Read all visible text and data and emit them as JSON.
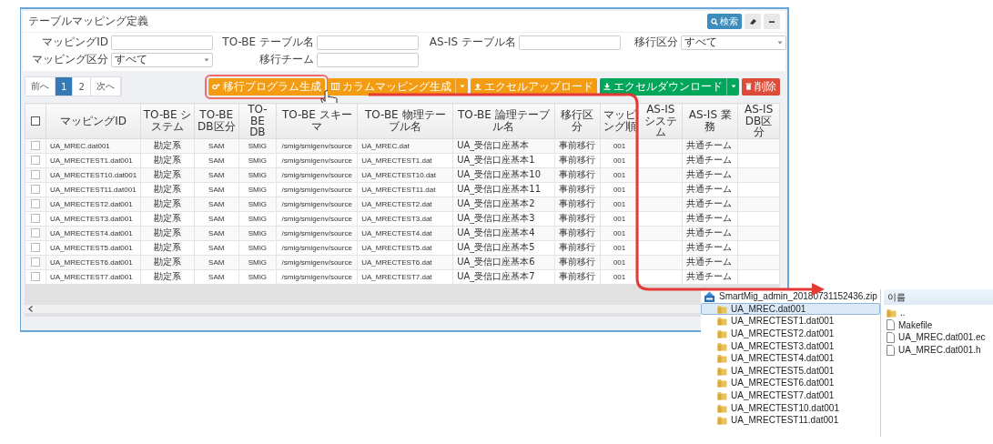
{
  "page": {
    "title": "テーブルマッピング定義"
  },
  "header_buttons": [
    {
      "kind": "search",
      "label": "検索"
    },
    {
      "kind": "eraser"
    },
    {
      "kind": "minimize"
    }
  ],
  "filters": [
    {
      "kind": "input",
      "label": "マッピングID"
    },
    {
      "kind": "input",
      "label": "TO-BE テーブル名"
    },
    {
      "kind": "input",
      "label": "AS-IS テーブル名"
    },
    {
      "kind": "select",
      "label": "移行区分",
      "value": "すべて"
    },
    {
      "kind": "select",
      "label": "マッピング区分",
      "value": "すべて"
    },
    {
      "kind": "input",
      "label": "移行チーム"
    }
  ],
  "pagination": [
    {
      "label": "前へ",
      "selected": false
    },
    {
      "label": "1",
      "selected": true
    },
    {
      "label": "2",
      "selected": false
    },
    {
      "label": "次へ",
      "selected": false
    }
  ],
  "toolbar": [
    {
      "kind": "program",
      "label": "移行プログラム生成",
      "color": "#f39c12",
      "dropdown": false,
      "highlighted": true
    },
    {
      "kind": "columns",
      "label": "カラムマッピング生成",
      "color": "#f39c12",
      "dropdown": true,
      "highlighted": false
    },
    {
      "kind": "upload",
      "label": "エクセルアップロード",
      "color": "#f39c12",
      "dropdown": false,
      "highlighted": false
    },
    {
      "kind": "download",
      "label": "エクセルダウンロード",
      "color": "#00a65a",
      "dropdown": true,
      "highlighted": false
    },
    {
      "kind": "delete",
      "label": "削除",
      "color": "#dd4b39",
      "dropdown": false,
      "highlighted": false
    }
  ],
  "table": {
    "select_all_checked": false,
    "columns": [
      "マッピングID",
      "TO-BE システム",
      "TO-BE DB区分",
      "TO-BE DB",
      "TO-BE スキーマ",
      "TO-BE 物理テーブル名",
      "TO-BE 論理テーブル名",
      "移行区分",
      "マッピング順",
      "AS-IS システム",
      "AS-IS 業務",
      "AS-IS DB区分"
    ],
    "rows": [
      {
        "checked": false,
        "mapping_id": "UA_MREC.dat001",
        "to_be_system": "勘定系",
        "to_be_db_type": "SAM",
        "to_be_db": "SMIG",
        "to_be_schema": "/smig/smigenv/source",
        "to_be_physical_table": "UA_MREC.dat",
        "to_be_logical_table": "UA_受信口座基本",
        "migration_type": "事前移行",
        "mapping_order": "001",
        "as_is_business": "共通チーム"
      },
      {
        "checked": false,
        "mapping_id": "UA_MRECTEST1.dat001",
        "to_be_system": "勘定系",
        "to_be_db_type": "SAM",
        "to_be_db": "SMIG",
        "to_be_schema": "/smig/smigenv/source",
        "to_be_physical_table": "UA_MRECTEST1.dat",
        "to_be_logical_table": "UA_受信口座基本1",
        "migration_type": "事前移行",
        "mapping_order": "001",
        "as_is_business": "共通チーム"
      },
      {
        "checked": false,
        "mapping_id": "UA_MRECTEST10.dat001",
        "to_be_system": "勘定系",
        "to_be_db_type": "SAM",
        "to_be_db": "SMIG",
        "to_be_schema": "/smig/smigenv/source",
        "to_be_physical_table": "UA_MRECTEST10.dat",
        "to_be_logical_table": "UA_受信口座基本10",
        "migration_type": "事前移行",
        "mapping_order": "001",
        "as_is_business": "共通チーム"
      },
      {
        "checked": false,
        "mapping_id": "UA_MRECTEST11.dat001",
        "to_be_system": "勘定系",
        "to_be_db_type": "SAM",
        "to_be_db": "SMIG",
        "to_be_schema": "/smig/smigenv/source",
        "to_be_physical_table": "UA_MRECTEST11.dat",
        "to_be_logical_table": "UA_受信口座基本11",
        "migration_type": "事前移行",
        "mapping_order": "001",
        "as_is_business": "共通チーム"
      },
      {
        "checked": false,
        "mapping_id": "UA_MRECTEST2.dat001",
        "to_be_system": "勘定系",
        "to_be_db_type": "SAM",
        "to_be_db": "SMIG",
        "to_be_schema": "/smig/smigenv/source",
        "to_be_physical_table": "UA_MRECTEST2.dat",
        "to_be_logical_table": "UA_受信口座基本2",
        "migration_type": "事前移行",
        "mapping_order": "001",
        "as_is_business": "共通チーム"
      },
      {
        "checked": false,
        "mapping_id": "UA_MRECTEST3.dat001",
        "to_be_system": "勘定系",
        "to_be_db_type": "SAM",
        "to_be_db": "SMIG",
        "to_be_schema": "/smig/smigenv/source",
        "to_be_physical_table": "UA_MRECTEST3.dat",
        "to_be_logical_table": "UA_受信口座基本3",
        "migration_type": "事前移行",
        "mapping_order": "001",
        "as_is_business": "共通チーム"
      },
      {
        "checked": false,
        "mapping_id": "UA_MRECTEST4.dat001",
        "to_be_system": "勘定系",
        "to_be_db_type": "SAM",
        "to_be_db": "SMIG",
        "to_be_schema": "/smig/smigenv/source",
        "to_be_physical_table": "UA_MRECTEST4.dat",
        "to_be_logical_table": "UA_受信口座基本4",
        "migration_type": "事前移行",
        "mapping_order": "001",
        "as_is_business": "共通チーム"
      },
      {
        "checked": false,
        "mapping_id": "UA_MRECTEST5.dat001",
        "to_be_system": "勘定系",
        "to_be_db_type": "SAM",
        "to_be_db": "SMIG",
        "to_be_schema": "/smig/smigenv/source",
        "to_be_physical_table": "UA_MRECTEST5.dat",
        "to_be_logical_table": "UA_受信口座基本5",
        "migration_type": "事前移行",
        "mapping_order": "001",
        "as_is_business": "共通チーム"
      },
      {
        "checked": false,
        "mapping_id": "UA_MRECTEST6.dat001",
        "to_be_system": "勘定系",
        "to_be_db_type": "SAM",
        "to_be_db": "SMIG",
        "to_be_schema": "/smig/smigenv/source",
        "to_be_physical_table": "UA_MRECTEST6.dat",
        "to_be_logical_table": "UA_受信口座基本6",
        "migration_type": "事前移行",
        "mapping_order": "001",
        "as_is_business": "共通チーム"
      },
      {
        "checked": false,
        "mapping_id": "UA_MRECTEST7.dat001",
        "to_be_system": "勘定系",
        "to_be_db_type": "SAM",
        "to_be_db": "SMIG",
        "to_be_schema": "/smig/smigenv/source",
        "to_be_physical_table": "UA_MRECTEST7.dat",
        "to_be_logical_table": "UA_受信口座基本7",
        "migration_type": "事前移行",
        "mapping_order": "001",
        "as_is_business": "共通チーム"
      }
    ]
  },
  "archive_viewer": {
    "archive": "SmartMig_admin_20180731152436.zip",
    "folders": [
      {
        "name": "UA_MREC.dat001",
        "selected": true
      },
      {
        "name": "UA_MRECTEST1.dat001",
        "selected": false
      },
      {
        "name": "UA_MRECTEST2.dat001",
        "selected": false
      },
      {
        "name": "UA_MRECTEST3.dat001",
        "selected": false
      },
      {
        "name": "UA_MRECTEST4.dat001",
        "selected": false
      },
      {
        "name": "UA_MRECTEST5.dat001",
        "selected": false
      },
      {
        "name": "UA_MRECTEST6.dat001",
        "selected": false
      },
      {
        "name": "UA_MRECTEST7.dat001",
        "selected": false
      },
      {
        "name": "UA_MRECTEST10.dat001",
        "selected": false
      },
      {
        "name": "UA_MRECTEST11.dat001",
        "selected": false
      }
    ],
    "column_header": "이름",
    "files": [
      {
        "kind": "parent",
        "name": ".."
      },
      {
        "kind": "file",
        "name": "Makefile"
      },
      {
        "kind": "file",
        "name": "UA_MREC.dat001.ec"
      },
      {
        "kind": "file",
        "name": "UA_MREC.dat001.h"
      }
    ]
  }
}
